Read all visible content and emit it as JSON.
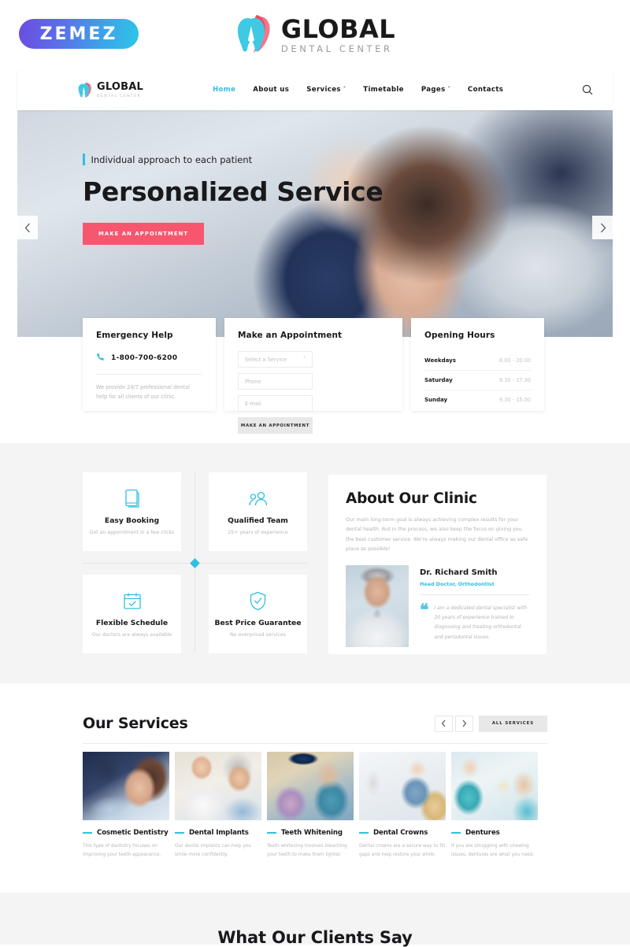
{
  "topbar": {
    "zemez_label": "ZEMEZ",
    "brand_main": "GLOBAL",
    "brand_sub": "DENTAL CENTER"
  },
  "nav": {
    "logo_main": "GLOBAL",
    "logo_sub": "DENTAL CENTER",
    "search_icon": "search-icon",
    "items": [
      {
        "label": "Home",
        "active": true,
        "caret": ""
      },
      {
        "label": "About us",
        "active": false,
        "caret": ""
      },
      {
        "label": "Services",
        "active": false,
        "caret": "ˇ"
      },
      {
        "label": "Timetable",
        "active": false,
        "caret": ""
      },
      {
        "label": "Pages",
        "active": false,
        "caret": "ˇ"
      },
      {
        "label": "Contacts",
        "active": false,
        "caret": ""
      }
    ]
  },
  "hero": {
    "kicker": "Individual approach to each patient",
    "title": "Personalized Service",
    "button": "MAKE AN APPOINTMENT",
    "prev_icon": "chevron-left-icon",
    "next_icon": "chevron-right-icon"
  },
  "emergency": {
    "title": "Emergency Help",
    "phone_icon": "phone-icon",
    "phone": "1-800-700-6200",
    "note": "We provide 24/7 professional dental help for all clients of our clinic."
  },
  "appointment": {
    "title": "Make an Appointment",
    "select_placeholder": "Select a Service",
    "select_caret": "ˇ",
    "phone_placeholder": "Phone",
    "email_placeholder": "E-mail",
    "submit_label": "MAKE AN APPOINTMENT"
  },
  "hours": {
    "title": "Opening Hours",
    "rows": [
      {
        "day": "Weekdays",
        "time": "8.00 - 20.00"
      },
      {
        "day": "Saturday",
        "time": "9.30 - 17.30"
      },
      {
        "day": "Sunday",
        "time": "9.30 - 15.00"
      }
    ]
  },
  "features": [
    {
      "icon": "book-icon",
      "title": "Easy Booking",
      "sub": "Get an appointment in a few clicks"
    },
    {
      "icon": "people-icon",
      "title": "Qualified Team",
      "sub": "25+ years of experience"
    },
    {
      "icon": "calendar-check-icon",
      "title": "Flexible Schedule",
      "sub": "Our doctors are always available"
    },
    {
      "icon": "shield-check-icon",
      "title": "Best Price Guarantee",
      "sub": "No overpriced services"
    }
  ],
  "about": {
    "title": "About Our Clinic",
    "paragraph": "Our main long-term goal is always achieving complex results for your dental health. But in the process, we also keep the focus on giving you the best customer service. We're always making our dental office as safe place as possible!",
    "doctor_name": "Dr. Richard Smith",
    "doctor_role": "Head Doctor, Orthodontist",
    "quote_mark": "❝",
    "quote": "I am a dedicated dental specialist with 20 years of experience trained in diagnosing and treating orthodontal and periodontal issues."
  },
  "services": {
    "title": "Our Services",
    "prev_icon": "chevron-left-icon",
    "next_icon": "chevron-right-icon",
    "all_label": "ALL SERVICES",
    "items": [
      {
        "name": "Cosmetic Dentistry",
        "desc": "This type of dentistry focuses on improving your teeth appearance."
      },
      {
        "name": "Dental Implants",
        "desc": "Our dental implants can help you smile more confidently."
      },
      {
        "name": "Teeth Whitening",
        "desc": "Teeth whitening involves bleaching your teeth to make them lighter."
      },
      {
        "name": "Dental Crowns",
        "desc": "Dental crowns are a secure way to fill gaps and help restore your smile."
      },
      {
        "name": "Dentures",
        "desc": "If you are struggling with chewing issues, dentures are what you need."
      }
    ]
  },
  "testimonials": {
    "title": "What Our Clients Say"
  },
  "colors": {
    "accent_cyan": "#2fc0e0",
    "accent_pink": "#f7566f",
    "text_dark": "#19191c",
    "muted": "#b5b8bd",
    "section_grey": "#f4f4f5"
  }
}
